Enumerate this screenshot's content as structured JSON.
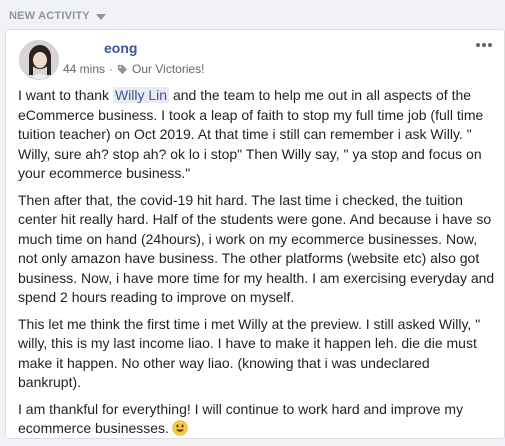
{
  "section": {
    "title": "NEW ACTIVITY"
  },
  "post": {
    "author": "eong",
    "time": "44 mins",
    "separator": "·",
    "group": "Our Victories!",
    "paragraph1": {
      "before": "I want to thank ",
      "mention": "Willy Lin",
      "after": " and the team to help me out in all aspects of the eCommerce business. I took a leap of faith to stop my full time job (full time tuition teacher) on Oct 2019. At that time i still can remember i ask Willy. \" Willy, sure ah? stop ah? ok lo i stop\" Then Willy say, \" ya stop and focus on your ecommerce business.\""
    },
    "paragraph2": "Then after that, the covid-19 hit hard. The last time i checked, the tuition center hit really hard. Half of the students were gone. And because i have so much time on hand (24hours), i work on my ecommerce businesses. Now, not only amazon have business. The other platforms (website etc) also got business. Now, i have more time for my health. I am exercising everyday and spend 2 hours reading to improve on myself.",
    "paragraph3": "This let me think the first time i met Willy at the preview. I still asked Willy, \" willy, this is my last income liao. I have to make it happen leh. die die must make it happen. No other way liao. (knowing that i was undeclared bankrupt).",
    "paragraph4": "I am thankful for everything! I will continue to work hard and improve my ecommerce businesses.",
    "emoji": "smiling-face-emoji",
    "icons": {
      "more": "more-horizontal-icon",
      "tag": "tag-icon",
      "caret": "caret-down-icon"
    },
    "colors": {
      "link": "#385898",
      "mention_bg": "#e9ebee",
      "text": "#1d2129",
      "meta": "#616770"
    }
  }
}
